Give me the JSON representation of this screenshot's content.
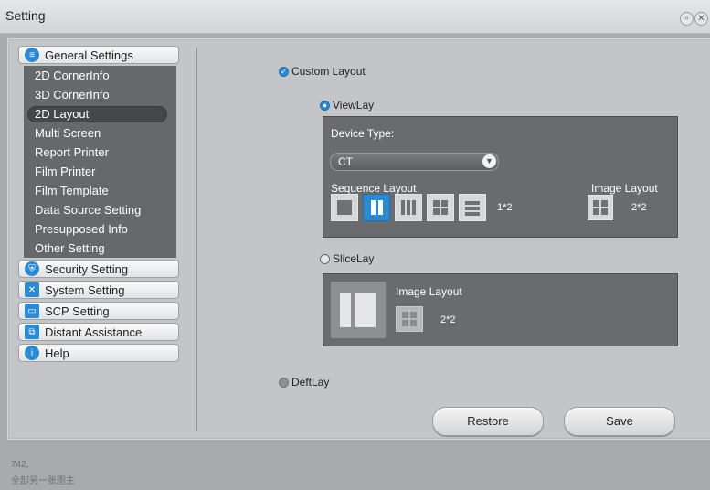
{
  "window": {
    "title": "Setting"
  },
  "nav": {
    "groups": [
      {
        "label": "General Settings",
        "icon": "list-icon",
        "color": "#2a8ad4"
      },
      {
        "label": "Security Setting",
        "icon": "shield-icon",
        "color": "#2a8ad4"
      },
      {
        "label": "System Setting",
        "icon": "tools-icon",
        "color": "#2a8ad4"
      },
      {
        "label": "SCP Setting",
        "icon": "monitor-icon",
        "color": "#2a8ad4"
      },
      {
        "label": "Distant Assistance",
        "icon": "network-icon",
        "color": "#2a8ad4"
      },
      {
        "label": "Help",
        "icon": "info-icon",
        "color": "#2a8ad4"
      }
    ],
    "general_items": [
      "2D CornerInfo",
      "3D CornerInfo",
      "2D Layout",
      "Multi Screen",
      "Report Printer",
      "Film Printer",
      "Film Template",
      "Data Source Setting",
      "Presupposed Info",
      "Other Setting"
    ],
    "active_item": "2D Layout"
  },
  "layout": {
    "custom_label": "Custom Layout",
    "viewlay_label": "ViewLay",
    "device_type_label": "Device Type:",
    "device_type_value": "CT",
    "sequence_layout_label": "Sequence Layout",
    "sequence_value": "1*2",
    "image_layout_label": "Image Layout",
    "image_layout_value": "2*2",
    "slicelay_label": "SliceLay",
    "slice_image_layout_label": "Image Layout",
    "slice_image_layout_value": "2*2",
    "deftlay_label": "DeftLay"
  },
  "buttons": {
    "restore": "Restore",
    "save": "Save"
  },
  "footer": {
    "line1": "742, ",
    "line2": "全部另一张图主"
  },
  "colors": {
    "accent": "#2a8ad4",
    "panel": "#6a6b6e",
    "nav_bg": "#67686b"
  }
}
